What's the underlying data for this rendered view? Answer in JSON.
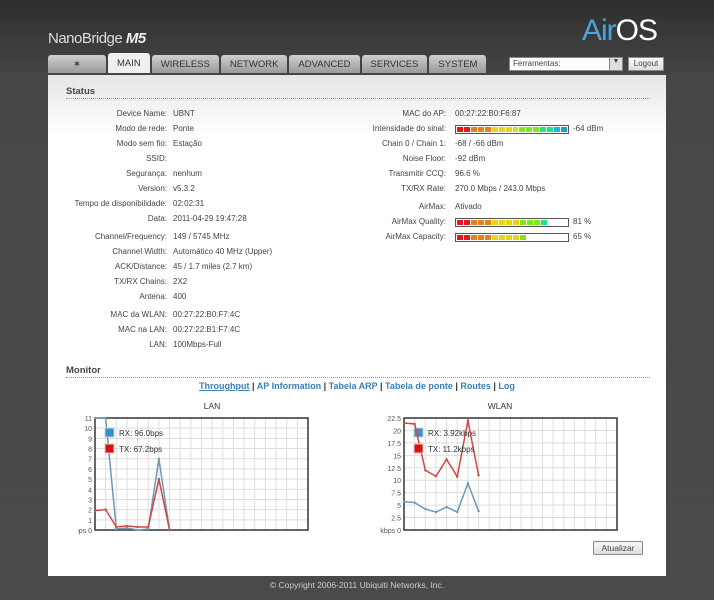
{
  "header": {
    "product": "NanoBridge",
    "model": "M5",
    "logo": "AirOS"
  },
  "tabs": [
    {
      "label": "",
      "icon": "ubiquiti-logo-icon"
    },
    {
      "label": "MAIN",
      "active": true
    },
    {
      "label": "WIRELESS"
    },
    {
      "label": "NETWORK"
    },
    {
      "label": "ADVANCED"
    },
    {
      "label": "SERVICES"
    },
    {
      "label": "SYSTEM"
    }
  ],
  "tools": {
    "selected": "Ferramentas:",
    "logout": "Logout"
  },
  "status": {
    "title": "Status",
    "left": [
      {
        "label": "Device Name:",
        "value": "UBNT"
      },
      {
        "label": "Modo de rede:",
        "value": "Ponte"
      },
      {
        "label": "Modo sem fio:",
        "value": "Estação"
      },
      {
        "label": "SSID:",
        "value": ""
      },
      {
        "label": "Segurança:",
        "value": "nenhum"
      },
      {
        "label": "Version:",
        "value": "v5.3.2"
      },
      {
        "label": "Tempo de disponibilidade:",
        "value": "02:02:31"
      },
      {
        "label": "Data:",
        "value": "2011-04-29 19:47:28"
      },
      {
        "label": "Channel/Frequency:",
        "value": "149 / 5745 MHz"
      },
      {
        "label": "Channel Width:",
        "value": "Automático 40 MHz (Upper)"
      },
      {
        "label": "ACK/Distance:",
        "value": "45 / 1.7 miles (2.7 km)"
      },
      {
        "label": "TX/RX Chains:",
        "value": "2X2"
      },
      {
        "label": "Antena:",
        "value": "400"
      },
      {
        "label": "MAC da WLAN:",
        "value": "00:27:22:B0:F7:4C"
      },
      {
        "label": "MAC na LAN:",
        "value": "00:27:22:B1:F7:4C"
      },
      {
        "label": "LAN:",
        "value": "100Mbps-Full"
      }
    ],
    "right": [
      {
        "label": "MAC do AP:",
        "value": "00:27:22:B0:F6:87"
      },
      {
        "label": "Intensidade do sinal:",
        "value": "-64 dBm",
        "bar": 1.0
      },
      {
        "label": "Chain 0 / Chain 1:",
        "value": "-68 / -66 dBm"
      },
      {
        "label": "Noise Floor:",
        "value": "-92 dBm"
      },
      {
        "label": "Transmitir CCQ:",
        "value": "96.6 %"
      },
      {
        "label": "TX/RX Rate:",
        "value": "270.0 Mbps / 243.0 Mbps"
      },
      {
        "label": "AirMax:",
        "value": "Ativado"
      },
      {
        "label": "AirMax Quality:",
        "value": "81 %",
        "bar": 0.81
      },
      {
        "label": "AirMax Capacity:",
        "value": "65 %",
        "bar": 0.65
      }
    ]
  },
  "monitor": {
    "title": "Monitor",
    "links": [
      "Throughput",
      "AP Information",
      "Tabela ARP",
      "Tabela de ponte",
      "Routes",
      "Log"
    ],
    "refresh": "Atualizar"
  },
  "colors": {
    "rx": "#3a8fc8",
    "tx": "#e01010",
    "rx_line": "#6b9ab8",
    "tx_line": "#d04848"
  },
  "chart_data": [
    {
      "type": "line",
      "title": "LAN",
      "ylabel": "kbps",
      "ylim": [
        0,
        11
      ],
      "yticks": [
        "0",
        "1",
        "2",
        "3",
        "4",
        "5",
        "6",
        "7",
        "8",
        "9",
        "10",
        "11"
      ],
      "grid": true,
      "legend": "top-left",
      "series": [
        {
          "name": "RX: 96.0bps",
          "values": [
            11,
            11,
            0.1,
            0.2,
            0,
            0.1,
            7,
            0
          ]
        },
        {
          "name": "TX: 67.2bps",
          "values": [
            1.9,
            2,
            0.3,
            0.4,
            0.3,
            0.3,
            5,
            0
          ]
        }
      ]
    },
    {
      "type": "line",
      "title": "WLAN",
      "ylabel": "kbps",
      "ylim": [
        0,
        22.5
      ],
      "yticks": [
        "0",
        "2.5",
        "5",
        "7.5",
        "10",
        "12.5",
        "15",
        "17.5",
        "20",
        "22.5"
      ],
      "grid": true,
      "legend": "top-left",
      "series": [
        {
          "name": "RX: 3.92kbps",
          "values": [
            5.7,
            5.5,
            4.2,
            3.6,
            4.6,
            3.6,
            9.4,
            3.8
          ]
        },
        {
          "name": "TX: 11.2kbps",
          "values": [
            21.5,
            21.3,
            12,
            10.8,
            14.2,
            10.7,
            22,
            11
          ]
        }
      ]
    }
  ],
  "footer": "© Copyright 2006-2011 Ubiquiti Networks, Inc."
}
